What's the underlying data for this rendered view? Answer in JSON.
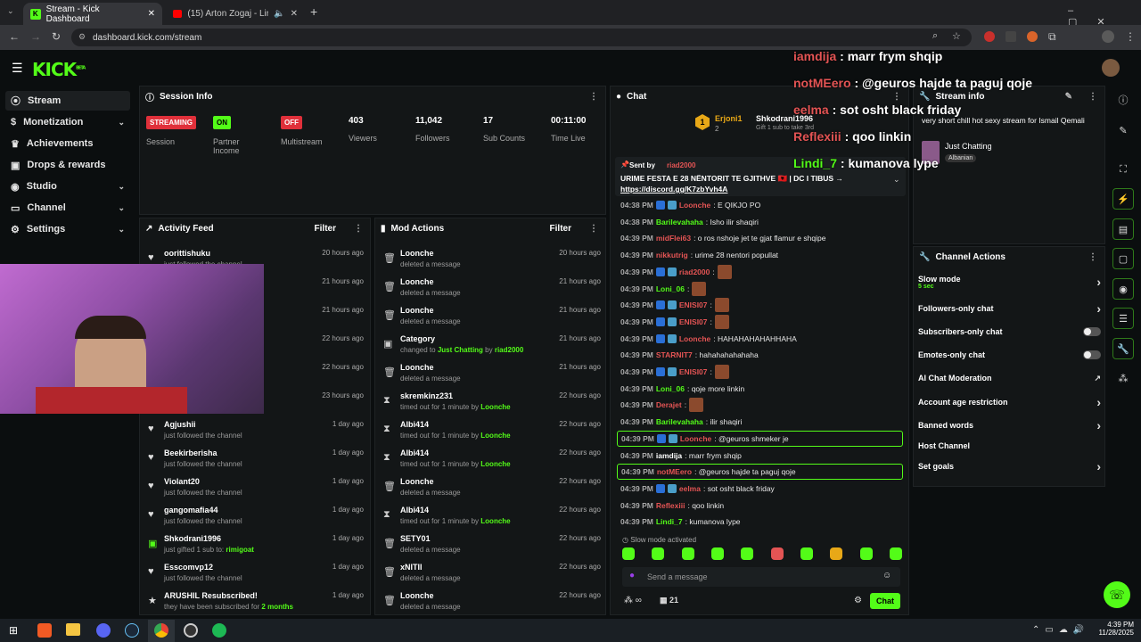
{
  "browser": {
    "tabs": [
      {
        "title": "Stream - Kick Dashboard"
      },
      {
        "title": "(15) Arton Zogaj - Liria Ka E"
      }
    ],
    "url": "dashboard.kick.com/stream"
  },
  "app": {
    "logo": "KICK",
    "beta": "BETA"
  },
  "sidebar": {
    "items": [
      {
        "label": "Stream",
        "icon": "stream-icon"
      },
      {
        "label": "Monetization",
        "icon": "dollar-icon"
      },
      {
        "label": "Achievements",
        "icon": "trophy-icon"
      },
      {
        "label": "Drops & rewards",
        "icon": "gift-icon"
      },
      {
        "label": "Studio",
        "icon": "studio-icon"
      },
      {
        "label": "Channel",
        "icon": "channel-icon"
      },
      {
        "label": "Settings",
        "icon": "gear-icon"
      }
    ]
  },
  "session": {
    "title": "Session Info",
    "stats": [
      {
        "badge": "STREAMING",
        "label": "Session"
      },
      {
        "badge": "ON",
        "label": "Partner Income"
      },
      {
        "badge": "OFF",
        "label": "Multistream"
      },
      {
        "value": "403",
        "label": "Viewers"
      },
      {
        "value": "11,042",
        "label": "Followers"
      },
      {
        "value": "17",
        "label": "Sub Counts"
      },
      {
        "value": "00:11:00",
        "label": "Time Live"
      }
    ]
  },
  "activity": {
    "title": "Activity Feed",
    "filter": "Filter",
    "items": [
      {
        "name": "oorittishuku",
        "sub": "just followed the channel",
        "time": "20 hours ago"
      },
      {
        "name": "",
        "sub": "",
        "time": "21 hours ago"
      },
      {
        "name": "",
        "sub": "",
        "time": "21 hours ago"
      },
      {
        "name": "",
        "sub": "",
        "time": "22 hours ago"
      },
      {
        "name": "",
        "sub": "",
        "time": "22 hours ago"
      },
      {
        "name": "",
        "sub": "",
        "time": "23 hours ago"
      },
      {
        "name": "Agjushii",
        "sub": "just followed the channel",
        "time": "1 day ago"
      },
      {
        "name": "Beekirberisha",
        "sub": "just followed the channel",
        "time": "1 day ago"
      },
      {
        "name": "Violant20",
        "sub": "just followed the channel",
        "time": "1 day ago"
      },
      {
        "name": "gangomafia44",
        "sub": "just followed the channel",
        "time": "1 day ago"
      },
      {
        "name": "Shkodrani1996",
        "sub": "just gifted 1 sub to:",
        "extra": "rimigoat",
        "time": "1 day ago"
      },
      {
        "name": "Esscomvp12",
        "sub": "just followed the channel",
        "time": "1 day ago"
      },
      {
        "name": "ARUSHIL Resubscribed!",
        "sub": "they have been subscribed for",
        "extra": "2 months",
        "time": "1 day ago"
      }
    ]
  },
  "mod": {
    "title": "Mod Actions",
    "filter": "Filter",
    "items": [
      {
        "name": "Loonche",
        "sub": "deleted a message",
        "time": "20 hours ago",
        "icon": "trash-icon"
      },
      {
        "name": "Loonche",
        "sub": "deleted a message",
        "time": "21 hours ago",
        "icon": "trash-icon"
      },
      {
        "name": "Loonche",
        "sub": "deleted a message",
        "time": "21 hours ago",
        "icon": "trash-icon"
      },
      {
        "name": "Category",
        "sub": "changed to",
        "extra": "Just Chatting",
        "by": "riad2000",
        "time": "21 hours ago",
        "icon": "category-icon"
      },
      {
        "name": "Loonche",
        "sub": "deleted a message",
        "time": "21 hours ago",
        "icon": "trash-icon"
      },
      {
        "name": "skremkinz231",
        "sub": "timed out for 1 minute by",
        "extra": "Loonche",
        "time": "22 hours ago",
        "icon": "hourglass-icon"
      },
      {
        "name": "Albi414",
        "sub": "timed out for 1 minute by",
        "extra": "Loonche",
        "time": "22 hours ago",
        "icon": "hourglass-icon"
      },
      {
        "name": "Albi414",
        "sub": "timed out for 1 minute by",
        "extra": "Loonche",
        "time": "22 hours ago",
        "icon": "hourglass-icon"
      },
      {
        "name": "Loonche",
        "sub": "deleted a message",
        "time": "22 hours ago",
        "icon": "trash-icon"
      },
      {
        "name": "Albi414",
        "sub": "timed out for 1 minute by",
        "extra": "Loonche",
        "time": "22 hours ago",
        "icon": "hourglass-icon"
      },
      {
        "name": "SETY01",
        "sub": "deleted a message",
        "time": "22 hours ago",
        "icon": "trash-icon"
      },
      {
        "name": "xNITII",
        "sub": "deleted a message",
        "time": "22 hours ago",
        "icon": "trash-icon"
      },
      {
        "name": "Loonche",
        "sub": "deleted a message",
        "time": "22 hours ago",
        "icon": "trash-icon"
      }
    ]
  },
  "chat": {
    "title": "Chat",
    "gift": {
      "user": "Erjoni1",
      "count": "2",
      "gifter": "Shkodrani1996",
      "sub": "Gift 1 sub to take 3rd"
    },
    "pinned": {
      "sent_by": "Sent by",
      "pinner": "riad2000",
      "text": "URIME FESTA E 28 NËNTORIT TE GJITHVE 🇦🇱 | DC I TIBUS →",
      "link": "https://discord.gg/K7zbYvh4A"
    },
    "messages": [
      {
        "time": "04:38 PM",
        "user": "Loonche",
        "color": "#e35454",
        "text": ": E QIKJO PO",
        "badges": 2
      },
      {
        "time": "04:38 PM",
        "user": "Barilevahaha",
        "color": "#53fc18",
        "text": ": Isho ilir shaqiri",
        "badges": 0
      },
      {
        "time": "04:39 PM",
        "user": "midFlei63",
        "color": "#e35454",
        "text": ": o ros nshoje jet te gjat flamur e shqipe",
        "badges": 0
      },
      {
        "time": "04:39 PM",
        "user": "nikkutrig",
        "color": "#e35454",
        "text": ": urime 28 nentori popullat",
        "badges": 0
      },
      {
        "time": "04:39 PM",
        "user": "riad2000",
        "color": "#e35454",
        "text": ":",
        "badges": 2,
        "emote": true
      },
      {
        "time": "04:39 PM",
        "user": "Loni_06",
        "color": "#53fc18",
        "text": ":",
        "badges": 0,
        "emote": true
      },
      {
        "time": "04:39 PM",
        "user": "ENISI07",
        "color": "#e35454",
        "text": ":",
        "badges": 2,
        "emote": true
      },
      {
        "time": "04:39 PM",
        "user": "ENISI07",
        "color": "#e35454",
        "text": ":",
        "badges": 2,
        "emote": true
      },
      {
        "time": "04:39 PM",
        "user": "Loonche",
        "color": "#e35454",
        "text": ": HAHAHAHAHAHHAHA",
        "badges": 2
      },
      {
        "time": "04:39 PM",
        "user": "STARNIT7",
        "color": "#e35454",
        "text": ": hahahahahahaha",
        "badges": 0
      },
      {
        "time": "04:39 PM",
        "user": "ENISI07",
        "color": "#e35454",
        "text": ":",
        "badges": 2,
        "emote": true
      },
      {
        "time": "04:39 PM",
        "user": "Loni_06",
        "color": "#53fc18",
        "text": ": qoje more linkin",
        "badges": 0
      },
      {
        "time": "04:39 PM",
        "user": "Derajet",
        "color": "#e35454",
        "text": ":",
        "badges": 0,
        "emote": true
      },
      {
        "time": "04:39 PM",
        "user": "Barilevahaha",
        "color": "#53fc18",
        "text": ": ilir shaqiri",
        "badges": 0
      },
      {
        "time": "04:39 PM",
        "user": "Loonche",
        "color": "#e35454",
        "text": ": @geuros shmeker je",
        "badges": 2,
        "hl": true
      },
      {
        "time": "04:39 PM",
        "user": "iamdija",
        "color": "#ffffff",
        "text": ": marr frym shqip",
        "badges": 0
      },
      {
        "time": "04:39 PM",
        "user": "notMEero",
        "color": "#e35454",
        "text": ": @geuros hajde ta paguj qoje",
        "badges": 0,
        "hl": true
      },
      {
        "time": "04:39 PM",
        "user": "eelma",
        "color": "#e35454",
        "text": ": sot osht black friday",
        "badges": 2
      },
      {
        "time": "04:39 PM",
        "user": "Reflexiii",
        "color": "#e35454",
        "text": ": qoo linkin",
        "badges": 0
      },
      {
        "time": "04:39 PM",
        "user": "Lindi_7",
        "color": "#53fc18",
        "text": ": kumanova lype",
        "badges": 0
      }
    ],
    "slow_mode": "Slow mode activated",
    "placeholder": "Send a message",
    "viewers": "21",
    "send": "Chat"
  },
  "overlay": [
    {
      "user": "iamdija",
      "text": " : marr frym shqip",
      "color": "#e35454"
    },
    {
      "user": "notMEero",
      "text": " : @geuros hajde ta paguj qoje",
      "color": "#e35454"
    },
    {
      "user": "eelma",
      "text": " : sot osht black friday",
      "color": "#e35454"
    },
    {
      "user": "Reflexiii",
      "text": " : qoo linkin",
      "color": "#e35454"
    },
    {
      "user": "Lindi_7",
      "text": " : kumanova lype",
      "color": "#53fc18"
    }
  ],
  "streaminfo": {
    "title": "Stream info",
    "desc": "very short chill hot sexy stream for Ismail Qemali",
    "category": "Just Chatting",
    "tag": "Albanian"
  },
  "actions": {
    "title": "Channel Actions",
    "items": [
      {
        "label": "Slow mode",
        "sub": "5 sec",
        "kind": "arrow"
      },
      {
        "label": "Followers-only chat",
        "kind": "arrow"
      },
      {
        "label": "Subscribers-only chat",
        "kind": "toggle"
      },
      {
        "label": "Emotes-only chat",
        "kind": "toggle"
      },
      {
        "label": "AI Chat Moderation",
        "kind": "ext"
      },
      {
        "label": "Account age restriction",
        "kind": "arrow"
      },
      {
        "label": "Banned words",
        "kind": "arrow"
      },
      {
        "label": "Host Channel",
        "kind": "none"
      },
      {
        "label": "Set goals",
        "kind": "arrow"
      }
    ]
  },
  "taskbar": {
    "time": "4:39 PM",
    "date": "11/28/2025"
  },
  "colors": {
    "accent": "#53fc18",
    "red": "#e35454"
  }
}
